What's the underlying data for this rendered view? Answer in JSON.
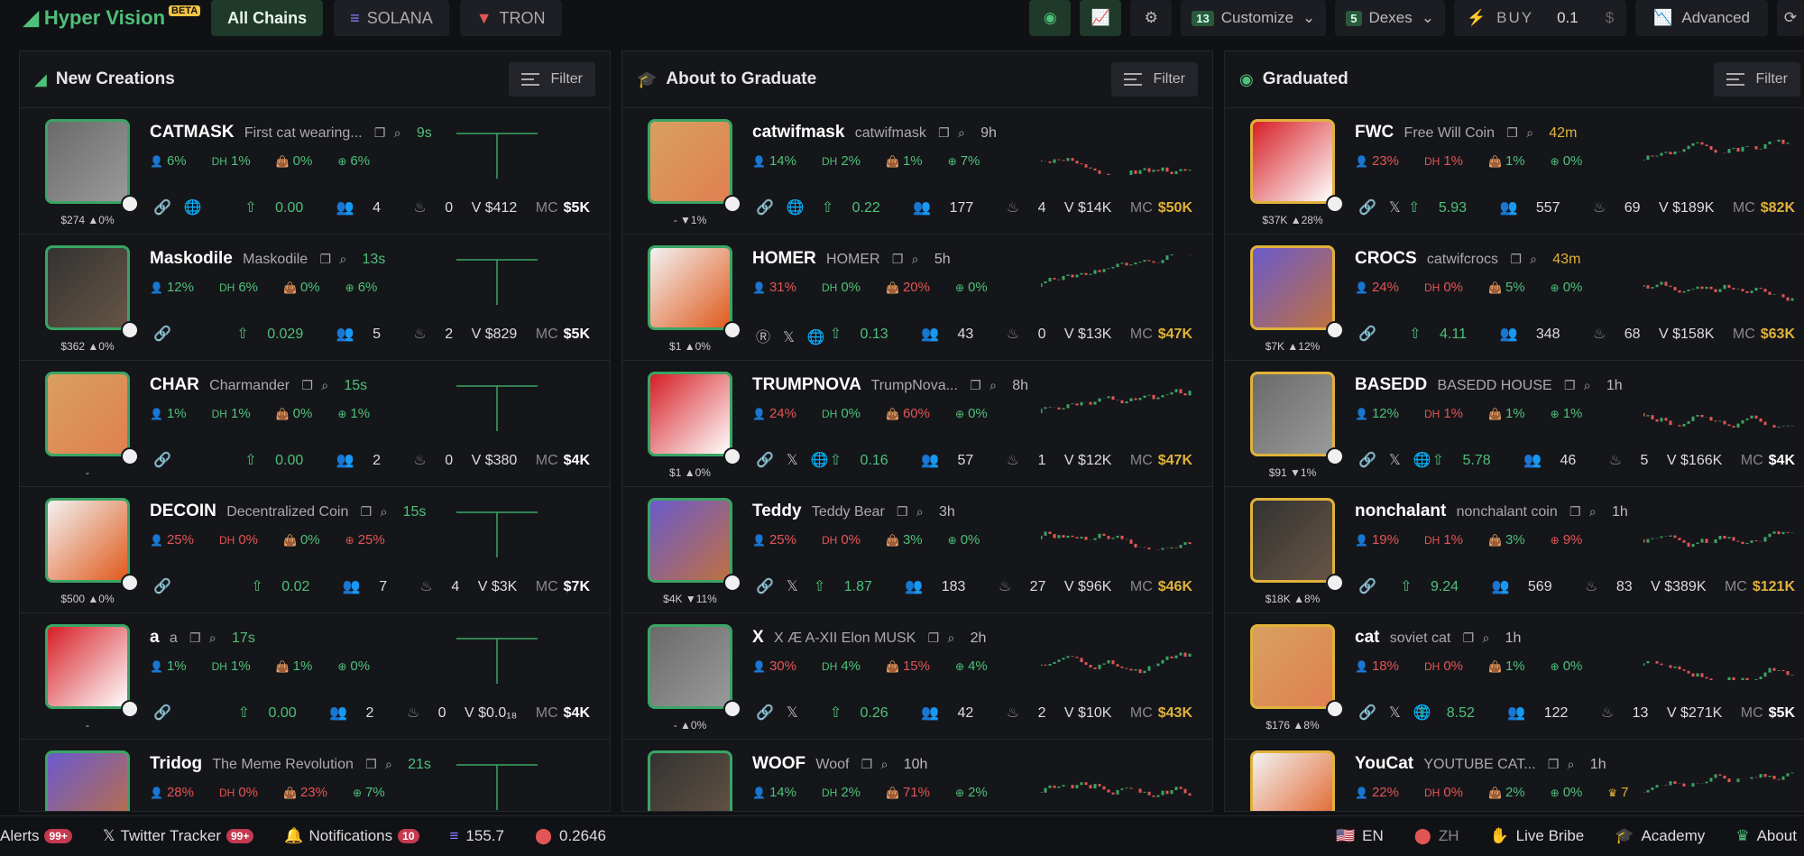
{
  "app": {
    "title": "Hyper Vision",
    "beta": "BETA"
  },
  "chains": [
    {
      "label": "All Chains"
    },
    {
      "label": "SOLANA"
    },
    {
      "label": "TRON"
    }
  ],
  "toolbar": {
    "customize_count": "13",
    "customize_label": "Customize",
    "dexes_count": "5",
    "dexes_label": "Dexes",
    "buy_label": "BUY",
    "buy_amount": "0.1",
    "buy_unit": "$",
    "advanced_label": "Advanced"
  },
  "columns": [
    {
      "title": "New Creations",
      "filter_label": "Filter",
      "rows": [
        {
          "ticker": "CATMASK",
          "name": "First cat wearing...",
          "age": "9s",
          "age_color": "green",
          "stats": [
            "6%",
            "1%",
            "0%",
            "6%"
          ],
          "stat_colors": [
            "g",
            "g",
            "g",
            "g"
          ],
          "under": "$274 ▲0%",
          "links": [
            "🔗",
            "🌐"
          ],
          "vol": "0.00",
          "holders": "4",
          "tx": "0",
          "v": "V $412",
          "mc": "$5K",
          "mc_color": "",
          "border": "green"
        },
        {
          "ticker": "Maskodile",
          "name": "Maskodile",
          "age": "13s",
          "age_color": "green",
          "stats": [
            "12%",
            "6%",
            "0%",
            "6%"
          ],
          "stat_colors": [
            "g",
            "g",
            "g",
            "g"
          ],
          "under": "$362 ▲0%",
          "links": [
            "🔗"
          ],
          "vol": "0.029",
          "holders": "5",
          "tx": "2",
          "v": "V $829",
          "mc": "$5K",
          "mc_color": "",
          "border": "green"
        },
        {
          "ticker": "CHAR",
          "name": "Charmander",
          "age": "15s",
          "age_color": "green",
          "stats": [
            "1%",
            "1%",
            "0%",
            "1%"
          ],
          "stat_colors": [
            "g",
            "g",
            "g",
            "g"
          ],
          "under": "-",
          "links": [
            "🔗"
          ],
          "vol": "0.00",
          "holders": "2",
          "tx": "0",
          "v": "V $380",
          "mc": "$4K",
          "mc_color": "",
          "border": "green"
        },
        {
          "ticker": "DECOIN",
          "name": "Decentralized Coin",
          "age": "15s",
          "age_color": "green",
          "stats": [
            "25%",
            "0%",
            "0%",
            "25%"
          ],
          "stat_colors": [
            "r",
            "r",
            "g",
            "r"
          ],
          "under": "$500 ▲0%",
          "links": [
            "🔗"
          ],
          "vol": "0.02",
          "holders": "7",
          "tx": "4",
          "v": "V $3K",
          "mc": "$7K",
          "mc_color": "",
          "border": "green"
        },
        {
          "ticker": "a",
          "name": "a",
          "age": "17s",
          "age_color": "green",
          "stats": [
            "1%",
            "1%",
            "1%",
            "0%"
          ],
          "stat_colors": [
            "g",
            "g",
            "g",
            "g"
          ],
          "under": "-",
          "links": [
            "🔗"
          ],
          "vol": "0.00",
          "holders": "2",
          "tx": "0",
          "v": "V $0.0₁₈",
          "mc": "$4K",
          "mc_color": "",
          "border": "green"
        },
        {
          "ticker": "Tridog",
          "name": "The Meme Revolution",
          "age": "21s",
          "age_color": "green",
          "stats": [
            "28%",
            "0%",
            "23%",
            "7%"
          ],
          "stat_colors": [
            "r",
            "r",
            "r",
            "g"
          ],
          "under": "",
          "links": [],
          "vol": "",
          "holders": "",
          "tx": "",
          "v": "",
          "mc": "",
          "mc_color": "",
          "border": "green"
        }
      ]
    },
    {
      "title": "About to Graduate",
      "filter_label": "Filter",
      "rows": [
        {
          "ticker": "catwifmask",
          "name": "catwifmask",
          "age": "9h",
          "age_color": "grey",
          "stats": [
            "14%",
            "2%",
            "1%",
            "7%"
          ],
          "stat_colors": [
            "g",
            "g",
            "g",
            "g"
          ],
          "under": "- ▼1%",
          "links": [
            "🔗",
            "🌐"
          ],
          "vol": "0.22",
          "holders": "177",
          "tx": "4",
          "v": "V $14K",
          "mc": "$50K",
          "mc_color": "gold",
          "border": "green"
        },
        {
          "ticker": "HOMER",
          "name": "HOMER",
          "age": "5h",
          "age_color": "grey",
          "stats": [
            "31%",
            "0%",
            "20%",
            "0%"
          ],
          "stat_colors": [
            "r",
            "g",
            "r",
            "g"
          ],
          "under": "$1 ▲0%",
          "links": [
            "Ⓡ",
            "𝕏",
            "🌐"
          ],
          "vol": "0.13",
          "holders": "43",
          "tx": "0",
          "v": "V $13K",
          "mc": "$47K",
          "mc_color": "gold",
          "border": "green"
        },
        {
          "ticker": "TRUMPNOVA",
          "name": "TrumpNova...",
          "age": "8h",
          "age_color": "grey",
          "stats": [
            "24%",
            "0%",
            "60%",
            "0%"
          ],
          "stat_colors": [
            "r",
            "g",
            "r",
            "g"
          ],
          "under": "$1 ▲0%",
          "links": [
            "🔗",
            "𝕏",
            "🌐"
          ],
          "vol": "0.16",
          "holders": "57",
          "tx": "1",
          "v": "V $12K",
          "mc": "$47K",
          "mc_color": "gold",
          "border": "green"
        },
        {
          "ticker": "Teddy",
          "name": "Teddy Bear",
          "age": "3h",
          "age_color": "grey",
          "stats": [
            "25%",
            "0%",
            "3%",
            "0%"
          ],
          "stat_colors": [
            "r",
            "r",
            "g",
            "g"
          ],
          "under": "$4K ▼11%",
          "links": [
            "🔗",
            "𝕏"
          ],
          "vol": "1.87",
          "holders": "183",
          "tx": "27",
          "v": "V $96K",
          "mc": "$46K",
          "mc_color": "gold",
          "border": "green"
        },
        {
          "ticker": "X",
          "name": "X Æ A-XII Elon MUSK",
          "age": "2h",
          "age_color": "grey",
          "stats": [
            "30%",
            "4%",
            "15%",
            "4%"
          ],
          "stat_colors": [
            "r",
            "g",
            "r",
            "g"
          ],
          "under": "- ▲0%",
          "links": [
            "🔗",
            "𝕏"
          ],
          "vol": "0.26",
          "holders": "42",
          "tx": "2",
          "v": "V $10K",
          "mc": "$43K",
          "mc_color": "gold",
          "border": "green"
        },
        {
          "ticker": "WOOF",
          "name": "Woof",
          "age": "10h",
          "age_color": "grey",
          "stats": [
            "14%",
            "2%",
            "71%",
            "2%"
          ],
          "stat_colors": [
            "g",
            "g",
            "r",
            "g"
          ],
          "under": "",
          "links": [],
          "vol": "",
          "holders": "",
          "tx": "",
          "v": "",
          "mc": "",
          "mc_color": "",
          "border": "green"
        }
      ]
    },
    {
      "title": "Graduated",
      "filter_label": "Filter",
      "rows": [
        {
          "ticker": "FWC",
          "name": "Free Will Coin",
          "age": "42m",
          "age_color": "gold",
          "stats": [
            "23%",
            "1%",
            "1%",
            "0%"
          ],
          "stat_colors": [
            "r",
            "r",
            "g",
            "g"
          ],
          "under": "$37K ▲28%",
          "links": [
            "🔗",
            "𝕏"
          ],
          "vol": "5.93",
          "holders": "557",
          "tx": "69",
          "v": "V $189K",
          "mc": "$82K",
          "mc_color": "gold",
          "border": "gold"
        },
        {
          "ticker": "CROCS",
          "name": "catwifcrocs",
          "age": "43m",
          "age_color": "gold",
          "stats": [
            "24%",
            "0%",
            "5%",
            "0%"
          ],
          "stat_colors": [
            "r",
            "r",
            "g",
            "g"
          ],
          "under": "$7K ▲12%",
          "links": [
            "🔗"
          ],
          "vol": "4.11",
          "holders": "348",
          "tx": "68",
          "v": "V $158K",
          "mc": "$63K",
          "mc_color": "gold",
          "border": "gold"
        },
        {
          "ticker": "BASEDD",
          "name": "BASEDD HOUSE",
          "age": "1h",
          "age_color": "grey",
          "stats": [
            "12%",
            "1%",
            "1%",
            "1%"
          ],
          "stat_colors": [
            "g",
            "r",
            "g",
            "g"
          ],
          "under": "$91 ▼1%",
          "links": [
            "🔗",
            "𝕏",
            "🌐"
          ],
          "vol": "5.78",
          "holders": "46",
          "tx": "5",
          "v": "V $166K",
          "mc": "$4K",
          "mc_color": "",
          "border": "gold"
        },
        {
          "ticker": "nonchalant",
          "name": "nonchalant coin",
          "age": "1h",
          "age_color": "grey",
          "stats": [
            "19%",
            "1%",
            "3%",
            "9%"
          ],
          "stat_colors": [
            "r",
            "r",
            "g",
            "r"
          ],
          "under": "$18K ▲8%",
          "links": [
            "🔗"
          ],
          "vol": "9.24",
          "holders": "569",
          "tx": "83",
          "v": "V $389K",
          "mc": "$121K",
          "mc_color": "gold",
          "border": "gold"
        },
        {
          "ticker": "cat",
          "name": "soviet cat",
          "age": "1h",
          "age_color": "grey",
          "stats": [
            "18%",
            "0%",
            "1%",
            "0%"
          ],
          "stat_colors": [
            "r",
            "r",
            "g",
            "g"
          ],
          "under": "$176 ▲8%",
          "links": [
            "🔗",
            "𝕏",
            "🌐"
          ],
          "vol": "8.52",
          "holders": "122",
          "tx": "13",
          "v": "V $271K",
          "mc": "$5K",
          "mc_color": "",
          "border": "gold"
        },
        {
          "ticker": "YouCat",
          "name": "YOUTUBE CAT...",
          "age": "1h",
          "age_color": "grey",
          "stats": [
            "22%",
            "0%",
            "2%",
            "0%",
            "7"
          ],
          "stat_colors": [
            "r",
            "r",
            "g",
            "g",
            "gold"
          ],
          "under": "",
          "links": [],
          "vol": "",
          "holders": "",
          "tx": "",
          "v": "",
          "mc": "",
          "mc_color": "",
          "border": "gold"
        }
      ]
    }
  ],
  "footer": {
    "alerts": "Alerts",
    "alerts_count": "99+",
    "twitter": "Twitter Tracker",
    "twitter_count": "99+",
    "notifications": "Notifications",
    "notifications_count": "10",
    "price1": "155.7",
    "price2": "0.2646",
    "lang_en": "EN",
    "lang_zh": "ZH",
    "live_bribe": "Live Bribe",
    "academy": "Academy",
    "about": "About"
  },
  "colors": {
    "accent": "#4ec07a",
    "gold": "#e0b23a",
    "red": "#e25555",
    "bg": "#101114"
  }
}
